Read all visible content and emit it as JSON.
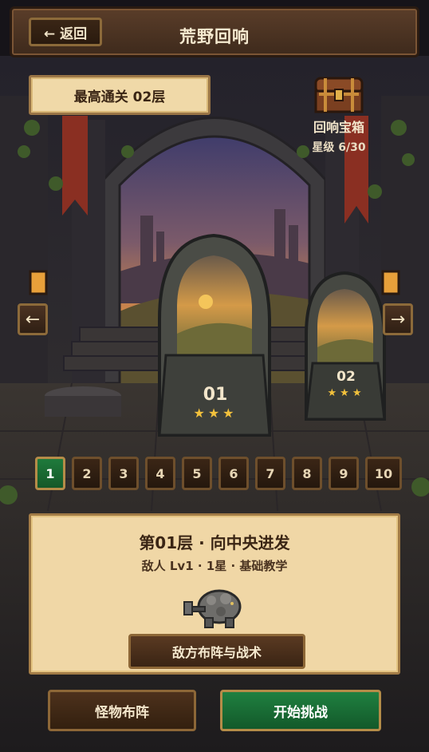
{
  "header": {
    "back_label": "← 返回",
    "title": "荒野回响"
  },
  "best_clear": "最高通关 02层",
  "chest": {
    "label": "回响宝箱",
    "stars": "星级 6/30",
    "icon": "treasure-chest-icon"
  },
  "nav": {
    "prev": "←",
    "next": "→"
  },
  "portals": [
    {
      "number": "01",
      "stars": "★★★"
    },
    {
      "number": "02",
      "stars": "★★★"
    }
  ],
  "levels": [
    "1",
    "2",
    "3",
    "4",
    "5",
    "6",
    "7",
    "8",
    "9",
    "10"
  ],
  "selected_level": "1",
  "stage": {
    "title": "第01层 · 向中央进发",
    "subtitle": "敌人 Lv1 · 1星 · 基础教学",
    "monster_icon": "stone-golem-icon",
    "tactics_label": "敌方布阵与战术"
  },
  "buttons": {
    "formation": "怪物布阵",
    "start": "开始挑战"
  },
  "colors": {
    "accent_green": "#1f8040",
    "star_gold": "#f2c13c",
    "panel": "#f0d9a8"
  }
}
